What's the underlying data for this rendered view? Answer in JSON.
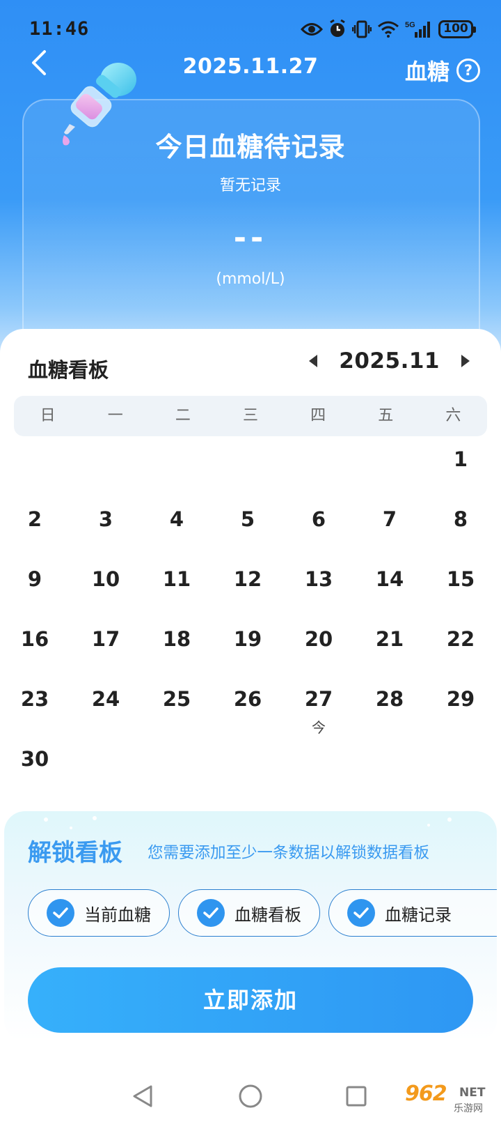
{
  "status_bar": {
    "time": "11:46",
    "battery": "100"
  },
  "header": {
    "date": "2025.11.27",
    "title": "血糖"
  },
  "today_card": {
    "title": "今日血糖待记录",
    "subtitle": "暂无记录",
    "value": "--",
    "unit": "(mmol/L)"
  },
  "board": {
    "title": "血糖看板",
    "month": "2025.11",
    "weekdays": [
      "日",
      "一",
      "二",
      "三",
      "四",
      "五",
      "六"
    ],
    "first_weekday_index": 6,
    "days_in_month": 30,
    "today": 27,
    "today_marker": "今"
  },
  "unlock": {
    "title": "解锁看板",
    "description": "您需要添加至少一条数据以解锁数据看板",
    "features": [
      "当前血糖",
      "血糖看板",
      "血糖记录"
    ]
  },
  "cta": {
    "label": "立即添加"
  },
  "watermark": {
    "brand": "962",
    "net": "NET",
    "sub": "乐游网"
  },
  "colors": {
    "primary": "#2f8ff5",
    "accent_text": "#3a9af0",
    "cta": "#2e97f3"
  }
}
